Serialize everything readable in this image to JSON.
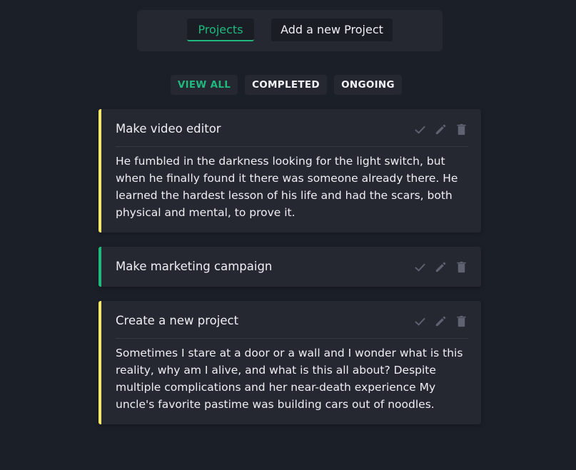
{
  "nav": {
    "projects_label": "Projects",
    "add_label": "Add a new Project",
    "accent": "#1fb97e"
  },
  "filters": {
    "view_all": "VIEW ALL",
    "completed": "COMPLETED",
    "ongoing": "ONGOING",
    "active": "VIEW ALL"
  },
  "projects": [
    {
      "title": "Make video editor",
      "details": "He fumbled in the darkness looking for the light switch, but when he finally found it there was someone already there. He learned the hardest lesson of his life and had the scars, both physical and mental, to prove it.",
      "status_color": "#f5e86a",
      "status": "ongoing"
    },
    {
      "title": "Make marketing campaign",
      "details": "",
      "status_color": "#1fb97e",
      "status": "completed"
    },
    {
      "title": "Create a new project",
      "details": "Sometimes I stare at a door or a wall and I wonder what is this reality, why am I alive, and what is this all about? Despite multiple complications and her near-death experience My uncle's favorite pastime was building cars out of noodles.",
      "status_color": "#f5e86a",
      "status": "ongoing"
    }
  ],
  "icons": {
    "complete": "check-icon",
    "edit": "pencil-icon",
    "delete": "trash-icon",
    "icon_color": "#5f6270"
  }
}
